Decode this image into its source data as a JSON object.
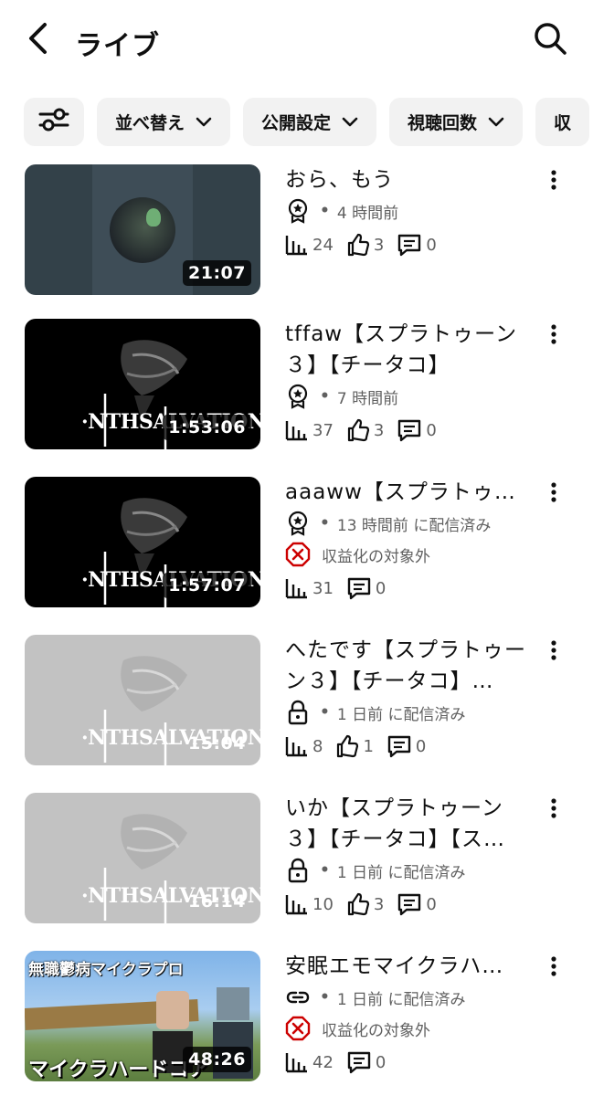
{
  "header": {
    "title": "ライブ"
  },
  "chips": [
    {
      "label": "並べ替え"
    },
    {
      "label": "公開設定"
    },
    {
      "label": "視聴回数"
    },
    {
      "label": "収"
    }
  ],
  "videos": [
    {
      "title": "おら、もう",
      "duration": "21:07",
      "visibility_icon": "badge-icon",
      "time": "4 時間前",
      "views": "24",
      "likes": "3",
      "comments": "0"
    },
    {
      "title": "tffaw【スプラトゥーン３】【チータコ】",
      "duration": "1:53:06",
      "thumb_logo": "NTHSALVATION",
      "visibility_icon": "badge-icon",
      "time": "7 時間前",
      "views": "37",
      "likes": "3",
      "comments": "0"
    },
    {
      "title": "aaaww【スプラトゥ…",
      "duration": "1:57:07",
      "thumb_logo": "NTHSALVATION",
      "visibility_icon": "badge-icon",
      "time": "13 時間前 に配信済み",
      "monetization": "収益化の対象外",
      "views": "31",
      "comments": "0"
    },
    {
      "title": "へたです【スプラトゥーン３】【チータコ】…",
      "duration": "15:04",
      "thumb_logo": "NTHSALVATION",
      "visibility_icon": "lock-icon",
      "time": "1 日前 に配信済み",
      "views": "8",
      "likes": "1",
      "comments": "0"
    },
    {
      "title": "いか【スプラトゥーン３】【チータコ】【ス…",
      "duration": "16:14",
      "thumb_logo": "NTHSALVATION",
      "visibility_icon": "lock-icon",
      "time": "1 日前 に配信済み",
      "views": "10",
      "likes": "3",
      "comments": "0"
    },
    {
      "title": "安眠エモマイクラハ…",
      "duration": "48:26",
      "thumb_top_text": "無職鬱病マイクラプロ",
      "thumb_bottom_text": "マイクラハードコア",
      "visibility_icon": "link-icon",
      "time": "1 日前 に配信済み",
      "monetization": "収益化の対象外",
      "views": "42",
      "comments": "0"
    }
  ]
}
